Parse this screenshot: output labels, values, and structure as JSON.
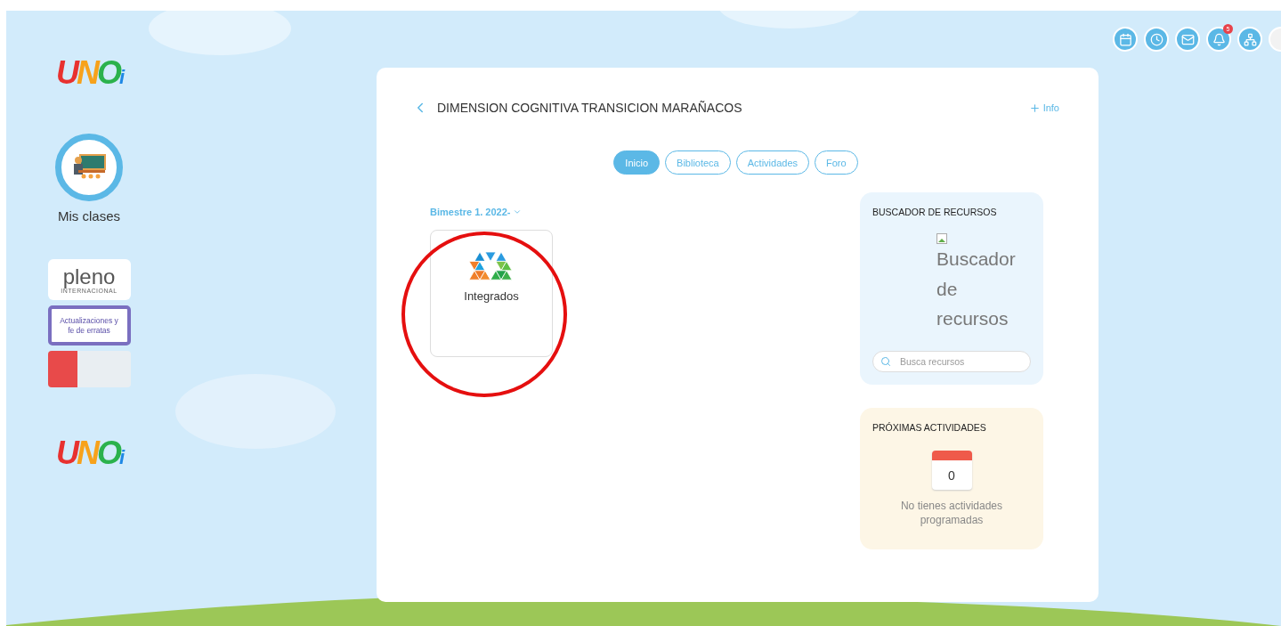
{
  "sidebar": {
    "logo_top": "UNOi",
    "classes_label": "Mis clases",
    "pleno": {
      "name": "pleno",
      "sub": "INTERNACIONAL"
    },
    "erratas_banner": "Actualizaciones y fe de erratas",
    "logo_bottom": "UNOi"
  },
  "top_icons": [
    {
      "kind": "calendar"
    },
    {
      "kind": "clock"
    },
    {
      "kind": "mail"
    },
    {
      "kind": "bell",
      "badge": "5"
    },
    {
      "kind": "org"
    },
    {
      "kind": "avatar"
    }
  ],
  "course": {
    "title": "DIMENSION COGNITIVA TRANSICION MARAÑACOS",
    "info": "Info",
    "tabs": [
      {
        "label": "Inicio",
        "selected": true
      },
      {
        "label": "Biblioteca",
        "selected": false
      },
      {
        "label": "Actividades",
        "selected": false
      },
      {
        "label": "Foro",
        "selected": false
      }
    ],
    "period": "Bimestre 1. 2022-",
    "tiles": [
      {
        "label": "Integrados"
      }
    ]
  },
  "resources": {
    "title": "BUSCADOR DE RECURSOS",
    "image_alt": "Buscador de recursos",
    "search_placeholder": "Busca recursos"
  },
  "upcoming": {
    "title": "PRÓXIMAS ACTIVIDADES",
    "count": "0",
    "empty": "No tienes actividades programadas"
  }
}
